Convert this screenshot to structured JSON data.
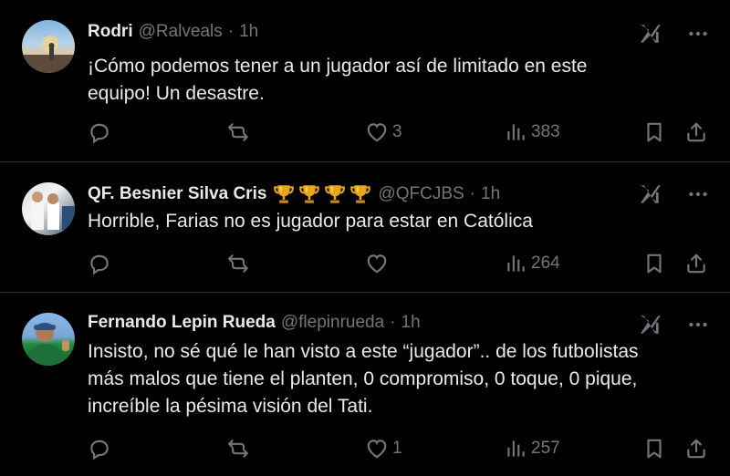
{
  "tweets": [
    {
      "name": "Rodri",
      "handle": "@Ralveals",
      "time": "1h",
      "lines": [
        "¡Cómo podemos tener a un jugador así de limitado en este",
        "equipo! Un desastre."
      ],
      "likes": "3",
      "views": "383"
    },
    {
      "name": "QF. Besnier Silva Cris",
      "handle": "@QFCJBS",
      "time": "1h",
      "lines": [
        "Horrible, Farias no es jugador para estar en Católica"
      ],
      "likes": "",
      "views": "264"
    },
    {
      "name": "Fernando Lepin Rueda",
      "handle": "@flepinrueda",
      "time": "1h",
      "lines": [
        "Insisto, no sé qué le han visto a este “jugador”.. de los futbolistas",
        "más malos que tiene el planten, 0 compromiso, 0 toque, 0 pique,",
        "increíble la pésima visión del Tati."
      ],
      "likes": "1",
      "views": "257"
    }
  ],
  "separator": "·",
  "icons": {
    "top": [
      "grok-icon",
      "more-icon"
    ],
    "actions": [
      "reply-icon",
      "retweet-icon",
      "like-icon",
      "views-icon",
      "bookmark-icon",
      "share-icon"
    ],
    "badges": [
      "trophy-icon",
      "trophy-icon",
      "trophy-icon",
      "trophy-icon"
    ]
  },
  "colors": {
    "background": "#000000",
    "text": "#e7e9ea",
    "muted": "#71767b",
    "border": "#2f3336",
    "trophy": "#e8a61a"
  }
}
